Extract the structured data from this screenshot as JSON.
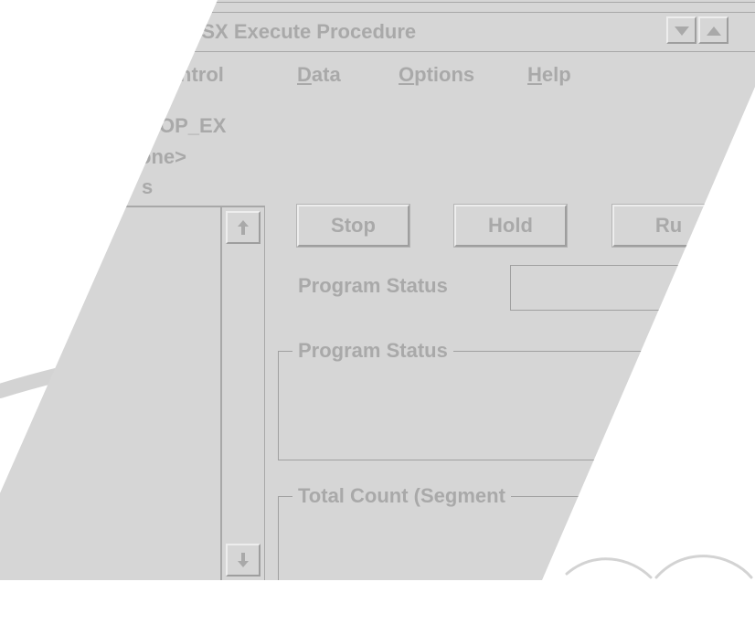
{
  "window": {
    "title": "are-SX Execute Procedure",
    "controls": {
      "minimize_icon": "triangle-down-icon",
      "maximize_icon": "triangle-up-icon"
    }
  },
  "menu": [
    {
      "label_pre": "",
      "mnemonic": "",
      "label_post": "ntrol"
    },
    {
      "label_pre": "",
      "mnemonic": "D",
      "label_post": "ata"
    },
    {
      "label_pre": "",
      "mnemonic": "O",
      "label_post": "ptions"
    },
    {
      "label_pre": "",
      "mnemonic": "H",
      "label_post": "elp"
    }
  ],
  "info": {
    "procedure": "OP_EX",
    "selection": "one>",
    "list_header": "s"
  },
  "scrollbar": {
    "up_icon": "arrow-up-icon",
    "down_icon": "arrow-down-icon"
  },
  "buttons": {
    "stop": "Stop",
    "hold": "Hold",
    "run": "Ru"
  },
  "program_status": {
    "label": "Program Status",
    "value": ""
  },
  "groups": {
    "program_status_title": "Program Status",
    "total_count_title": "Total Count (Segment"
  },
  "colors": {
    "window_bg": "#d6d6d6",
    "text": "#a9a9a9",
    "page_bg": "#ffffff"
  }
}
